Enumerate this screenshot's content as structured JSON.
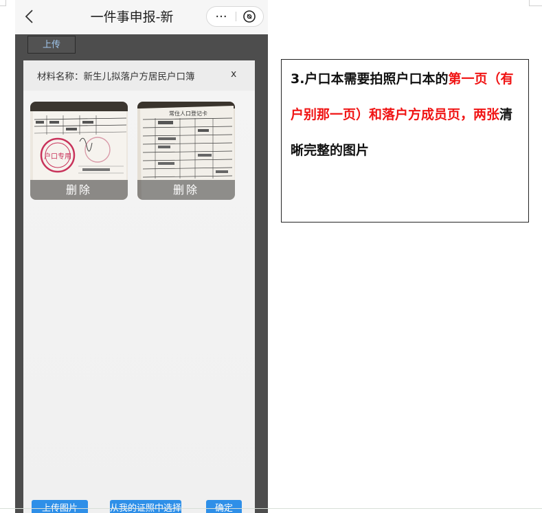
{
  "navbar": {
    "title": "一件事申报-新",
    "more_label": "···"
  },
  "upload_button": "上传",
  "modal": {
    "title": "材料名称：新生儿拟落户方居民户口簿",
    "close_label": "x",
    "images": [
      {
        "delete_label": "删除",
        "stamp_text": "户口专用"
      },
      {
        "delete_label": "删除",
        "doc_title": "常住人口登记卡"
      }
    ]
  },
  "bottom_buttons": [
    {
      "label": "上传图片"
    },
    {
      "label": "从我的证照中选择"
    },
    {
      "label": "确定"
    }
  ],
  "instruction": {
    "segments": [
      {
        "text": "3.户口本需要拍照户口本的",
        "color": "black"
      },
      {
        "text": "第一页（有户别那一页）和落户方成员页，两张",
        "color": "red"
      },
      {
        "text": "清晰完整的图片",
        "color": "black"
      }
    ],
    "colors": {
      "accent_red": "#f01414",
      "text": "#111111"
    }
  }
}
